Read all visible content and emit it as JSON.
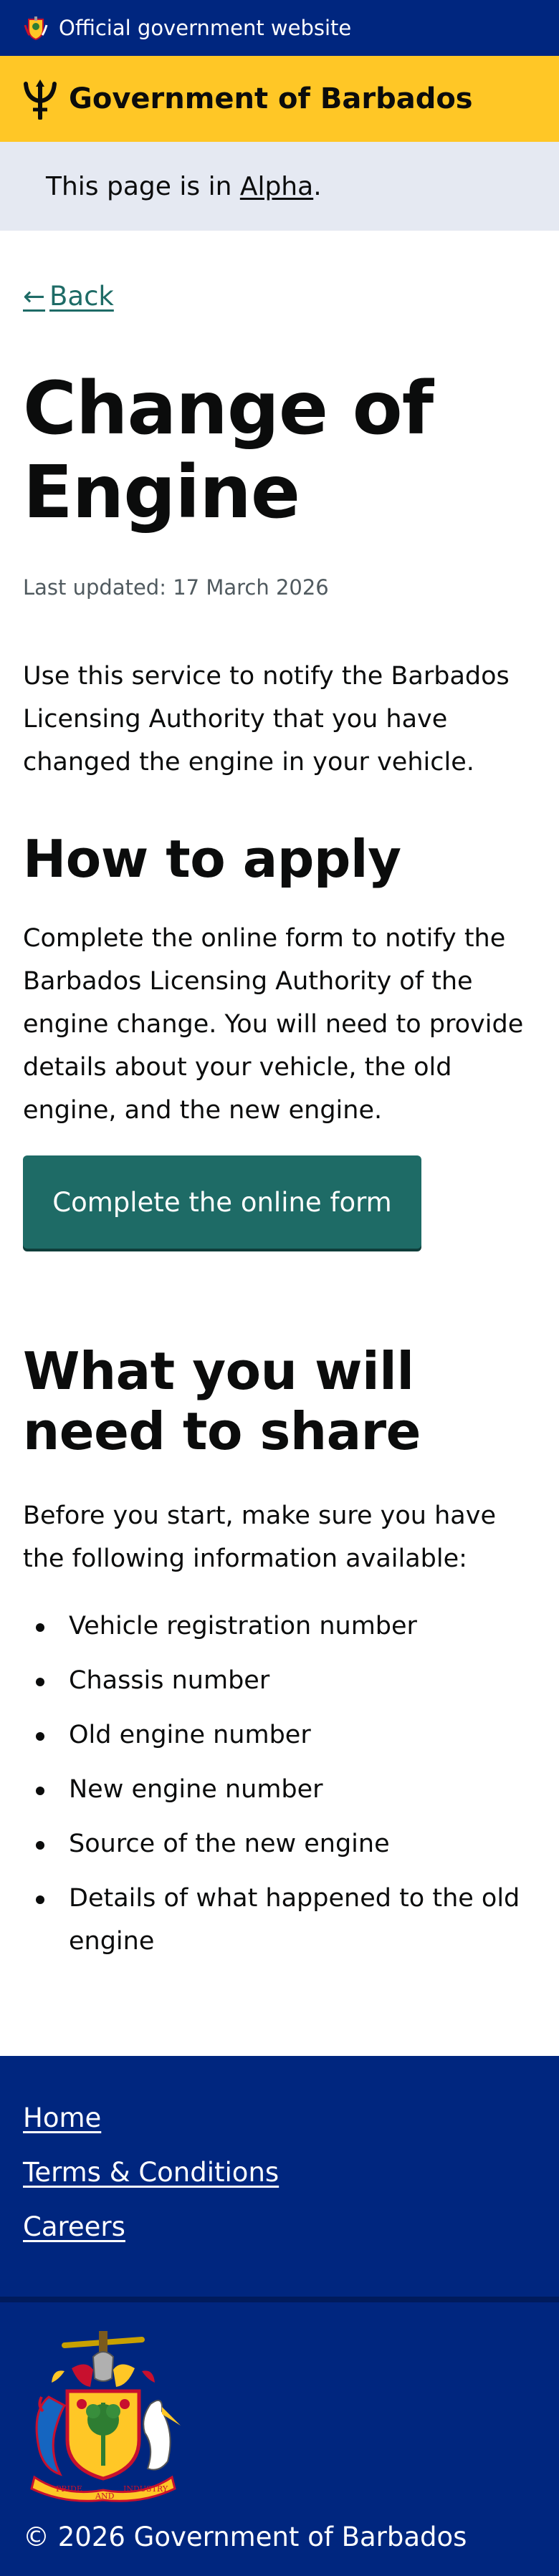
{
  "banner": {
    "official_text": "Official government website"
  },
  "brand": {
    "name": "Government of Barbados"
  },
  "phase": {
    "prefix": "This page is in ",
    "link": "Alpha",
    "suffix": "."
  },
  "nav": {
    "back_arrow": "←",
    "back_label": "Back"
  },
  "page": {
    "title": "Change of Engine",
    "updated": "Last updated: 17 March 2026",
    "intro": "Use this service to notify the Barbados Licensing Authority that you have changed the engine in your vehicle."
  },
  "how_to_apply": {
    "heading": "How to apply",
    "body": "Complete the online form to notify the Barbados Licensing Authority of the engine change. You will need to provide details about your vehicle, the old engine, and the new engine.",
    "button": "Complete the online form"
  },
  "share": {
    "heading": "What you will need to share",
    "body": "Before you start, make sure you have the following information available:",
    "items": [
      "Vehicle registration number",
      "Chassis number",
      "Old engine number",
      "New engine number",
      "Source of the new engine",
      "Details of what happened to the old engine"
    ]
  },
  "footer": {
    "links": [
      "Home",
      "Terms & Conditions",
      "Careers"
    ],
    "copyright": "© 2026 Government of Barbados",
    "coat_motto_left": "PRIDE",
    "coat_motto_mid": "AND",
    "coat_motto_right": "INDUSTRY"
  },
  "colors": {
    "navy": "#00267f",
    "gold": "#ffc726",
    "teal": "#1e6b66",
    "phase_bg": "#e5e9f2"
  },
  "icons": {
    "banner": "coat-of-arms-icon",
    "brand": "trident-icon",
    "footer": "coat-of-arms-icon"
  }
}
